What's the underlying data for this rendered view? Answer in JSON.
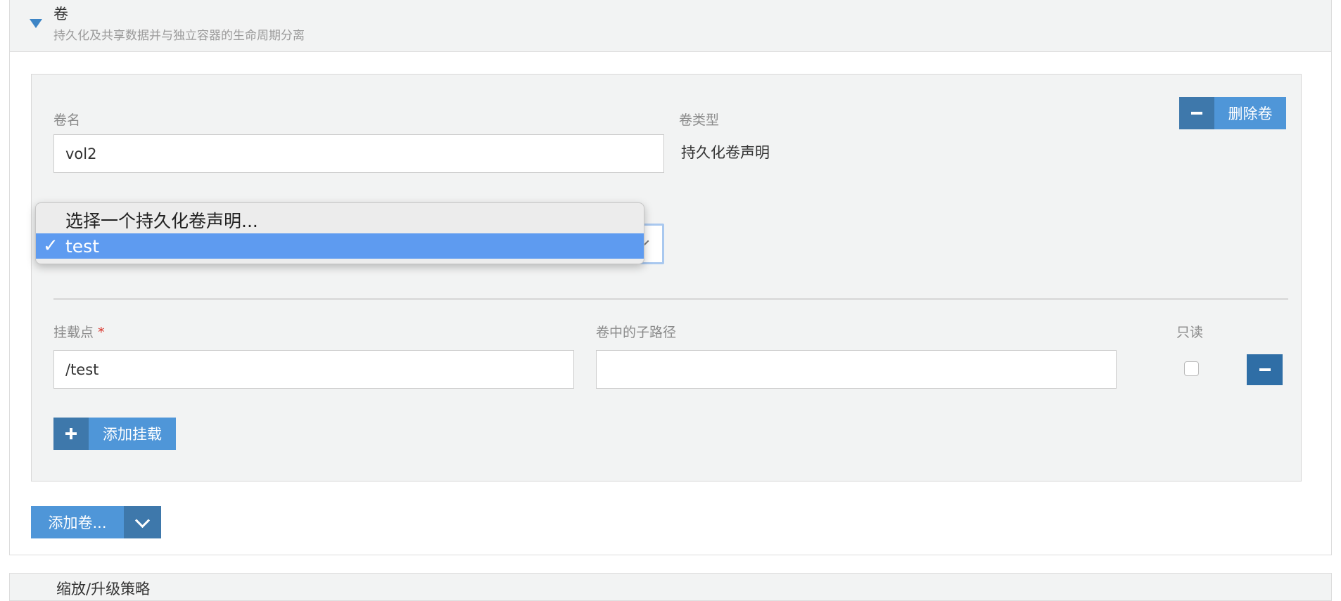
{
  "section": {
    "title": "卷",
    "subtitle": "持久化及共享数据并与独立容器的生命周期分离"
  },
  "volume": {
    "name_label": "卷名",
    "name_value": "vol2",
    "type_label": "卷类型",
    "type_value": "持久化卷声明",
    "delete_label": "删除卷",
    "claim_select": {
      "placeholder": "选择一个持久化卷声明...",
      "selected": "test",
      "options": [
        "选择一个持久化卷声明...",
        "test"
      ]
    }
  },
  "mount": {
    "mount_point_label": "挂载点",
    "required_marker": "*",
    "mount_point_value": "/test",
    "sub_path_label": "卷中的子路径",
    "sub_path_value": "",
    "readonly_label": "只读",
    "readonly_checked": false,
    "add_mount_label": "添加挂载"
  },
  "add_volume_label": "添加卷...",
  "next_section": {
    "title": "缩放/升级策略"
  },
  "colors": {
    "accent": "#4f96d8",
    "accent_dark": "#3e78ab",
    "selected_option": "#5e9bf0",
    "required": "#d9342b"
  }
}
